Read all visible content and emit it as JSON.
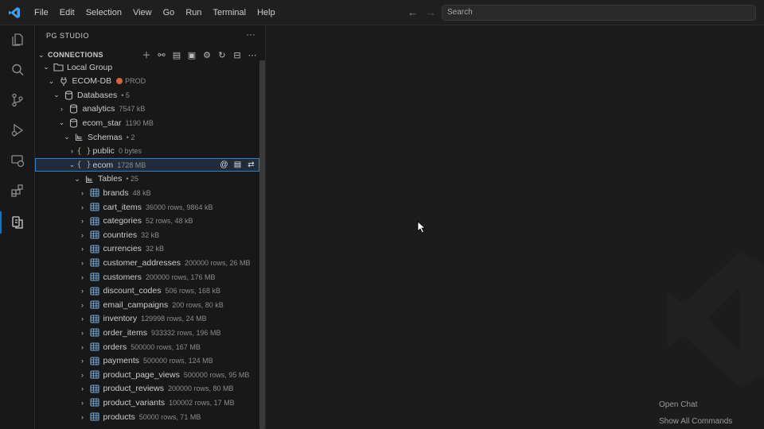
{
  "menu": [
    "File",
    "Edit",
    "Selection",
    "View",
    "Go",
    "Run",
    "Terminal",
    "Help"
  ],
  "search": {
    "placeholder": "Search"
  },
  "sidebar": {
    "title": "PG STUDIO",
    "section": "CONNECTIONS"
  },
  "tree": [
    {
      "depth": 0,
      "twisty": "open",
      "icon": "folder-icon",
      "label": "Local Group",
      "desc": ""
    },
    {
      "depth": 1,
      "twisty": "open",
      "icon": "plug-icon",
      "label": "ECOM-DB",
      "desc": "PROD",
      "dot": true
    },
    {
      "depth": 2,
      "twisty": "open",
      "icon": "database-icon",
      "label": "Databases",
      "desc": "• 5"
    },
    {
      "depth": 3,
      "twisty": "closed",
      "icon": "database-icon",
      "label": "analytics",
      "desc": "7547 kB"
    },
    {
      "depth": 3,
      "twisty": "open",
      "icon": "database-icon",
      "label": "ecom_star",
      "desc": "1190 MB"
    },
    {
      "depth": 4,
      "twisty": "open",
      "icon": "schemas-icon",
      "label": "Schemas",
      "desc": "• 2"
    },
    {
      "depth": 5,
      "twisty": "closed",
      "icon": "braces-icon",
      "label": "public",
      "desc": "0 bytes"
    },
    {
      "depth": 5,
      "twisty": "open",
      "icon": "braces-icon",
      "label": "ecom",
      "desc": "1728 MB",
      "selected": true
    },
    {
      "depth": 6,
      "twisty": "open",
      "icon": "schemas-icon",
      "label": "Tables",
      "desc": "• 25"
    },
    {
      "depth": 7,
      "twisty": "closed",
      "icon": "table-icon",
      "label": "brands",
      "desc": "48 kB"
    },
    {
      "depth": 7,
      "twisty": "closed",
      "icon": "table-icon",
      "label": "cart_items",
      "desc": "36000 rows, 9864 kB"
    },
    {
      "depth": 7,
      "twisty": "closed",
      "icon": "table-icon",
      "label": "categories",
      "desc": "52 rows, 48 kB"
    },
    {
      "depth": 7,
      "twisty": "closed",
      "icon": "table-icon",
      "label": "countries",
      "desc": "32 kB"
    },
    {
      "depth": 7,
      "twisty": "closed",
      "icon": "table-icon",
      "label": "currencies",
      "desc": "32 kB"
    },
    {
      "depth": 7,
      "twisty": "closed",
      "icon": "table-icon",
      "label": "customer_addresses",
      "desc": "200000 rows, 26 MB"
    },
    {
      "depth": 7,
      "twisty": "closed",
      "icon": "table-icon",
      "label": "customers",
      "desc": "200000 rows, 176 MB"
    },
    {
      "depth": 7,
      "twisty": "closed",
      "icon": "table-icon",
      "label": "discount_codes",
      "desc": "506 rows, 168 kB"
    },
    {
      "depth": 7,
      "twisty": "closed",
      "icon": "table-icon",
      "label": "email_campaigns",
      "desc": "200 rows, 80 kB"
    },
    {
      "depth": 7,
      "twisty": "closed",
      "icon": "table-icon",
      "label": "inventory",
      "desc": "129998 rows, 24 MB"
    },
    {
      "depth": 7,
      "twisty": "closed",
      "icon": "table-icon",
      "label": "order_items",
      "desc": "933332 rows, 196 MB"
    },
    {
      "depth": 7,
      "twisty": "closed",
      "icon": "table-icon",
      "label": "orders",
      "desc": "500000 rows, 167 MB"
    },
    {
      "depth": 7,
      "twisty": "closed",
      "icon": "table-icon",
      "label": "payments",
      "desc": "500000 rows, 124 MB"
    },
    {
      "depth": 7,
      "twisty": "closed",
      "icon": "table-icon",
      "label": "product_page_views",
      "desc": "500000 rows, 95 MB"
    },
    {
      "depth": 7,
      "twisty": "closed",
      "icon": "table-icon",
      "label": "product_reviews",
      "desc": "200000 rows, 80 MB"
    },
    {
      "depth": 7,
      "twisty": "closed",
      "icon": "table-icon",
      "label": "product_variants",
      "desc": "100002 rows, 17 MB"
    },
    {
      "depth": 7,
      "twisty": "closed",
      "icon": "table-icon",
      "label": "products",
      "desc": "50000 rows, 71 MB"
    }
  ],
  "editor": {
    "hints": [
      "Open Chat",
      "Show All Commands"
    ]
  },
  "colors": {
    "accent": "#0078d4",
    "selection": "#2f80c9",
    "prod_dot": "#d2643c"
  }
}
